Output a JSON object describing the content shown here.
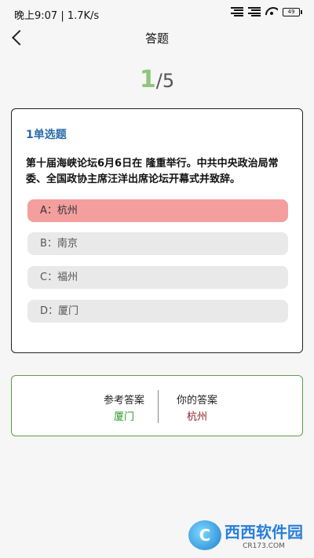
{
  "status": {
    "time": "晚上9:07 | 1.7K/s",
    "battery": "49"
  },
  "header": {
    "title": "答题"
  },
  "progress": {
    "current": "1",
    "total": "/5"
  },
  "question": {
    "type": "1单选题",
    "text": "第十届海峡论坛6月6日在 隆重举行。中共中央政治局常委、全国政协主席汪洋出席论坛开幕式并致辞。",
    "options": [
      "A：杭州",
      "B：南京",
      "C：福州",
      "D：厦门"
    ]
  },
  "answer": {
    "reference_label": "参考答案",
    "reference_value": "厦门",
    "yours_label": "你的答案",
    "yours_value": "杭州"
  },
  "colors": {
    "correct": "#2e9c2e",
    "wrong": "#8b1f1f",
    "selected_wrong_bg": "#f49e9e",
    "progress_current": "#8ec57b",
    "qtype": "#2b6aa8"
  },
  "watermark": {
    "text": "西西软件园",
    "sub": "CR173.COM"
  }
}
